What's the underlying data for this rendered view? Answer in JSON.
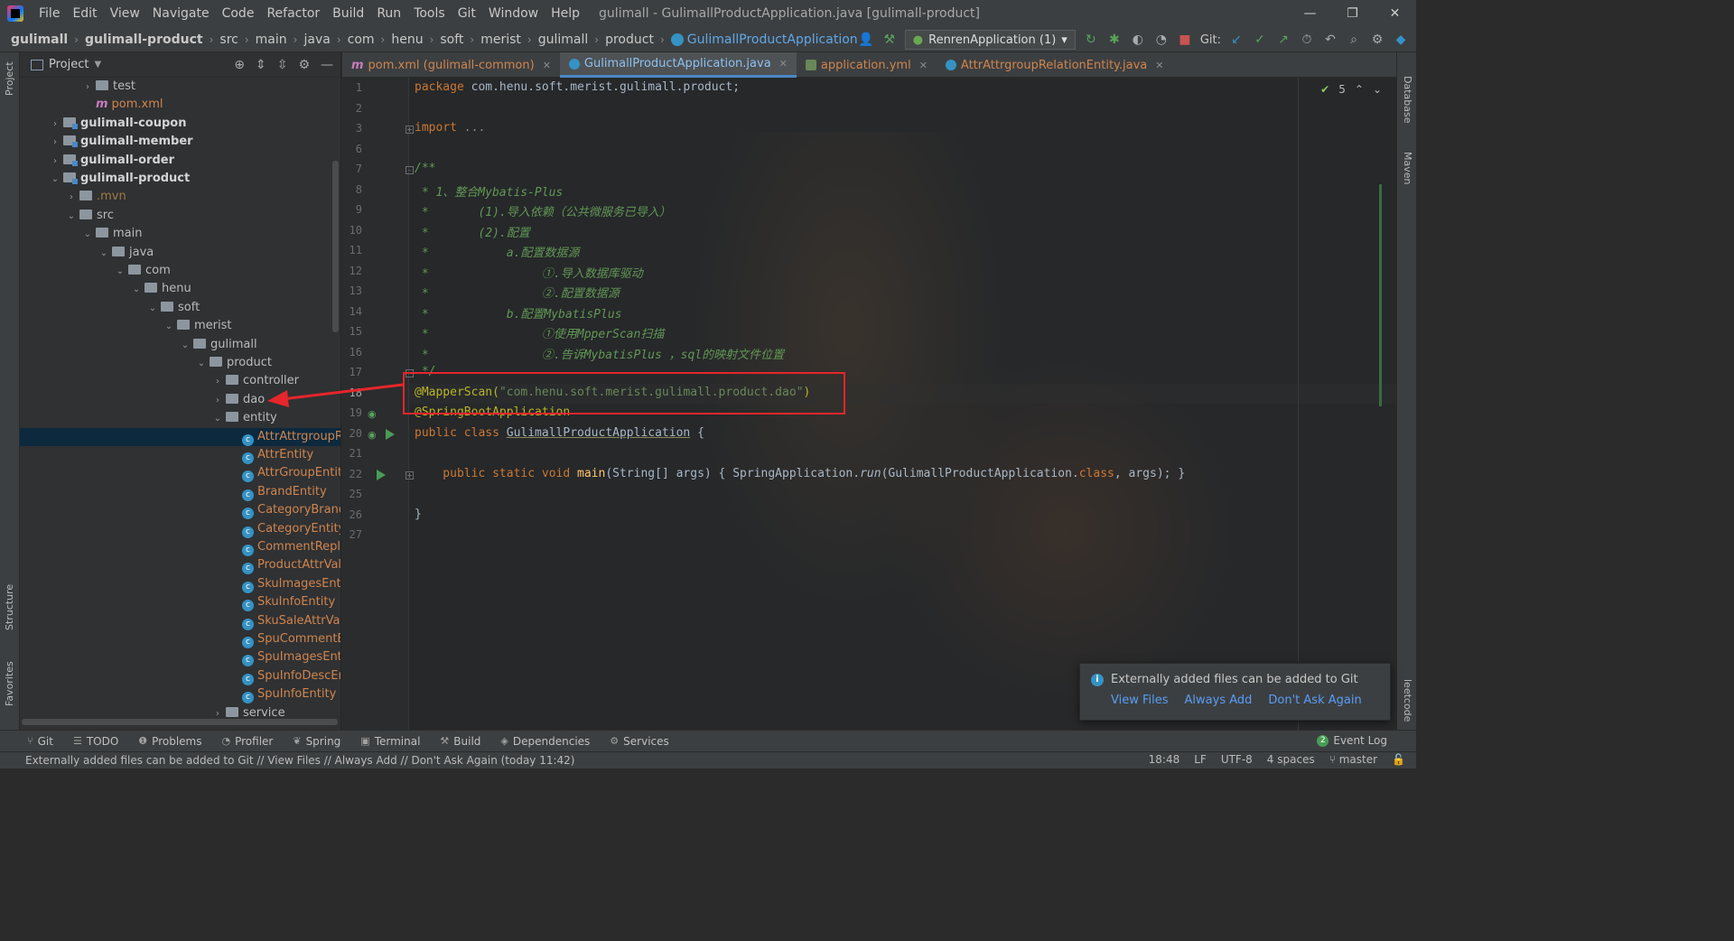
{
  "window": {
    "title": "gulimall - GulimallProductApplication.java [gulimall-product]",
    "menu": [
      "File",
      "Edit",
      "View",
      "Navigate",
      "Code",
      "Refactor",
      "Build",
      "Run",
      "Tools",
      "Git",
      "Window",
      "Help"
    ],
    "controls": [
      "—",
      "❐",
      "✕"
    ]
  },
  "navbar": {
    "crumbs": [
      "gulimall",
      "gulimall-product",
      "src",
      "main",
      "java",
      "com",
      "henu",
      "soft",
      "merist",
      "gulimall",
      "product",
      "GulimallProductApplication"
    ],
    "run_config": "RenrenApplication (1)",
    "git_label": "Git:"
  },
  "side": {
    "project": "Project",
    "structure": "Structure",
    "favorites": "Favorites",
    "database": "Database",
    "maven": "Maven",
    "leetcode": "leetcode"
  },
  "project_panel": {
    "title": "Project",
    "tree": [
      {
        "label": "test",
        "kind": "folder",
        "depth": 3,
        "arrow": "›"
      },
      {
        "label": "pom.xml",
        "kind": "maven",
        "depth": 3,
        "arrow": "",
        "style": "orange"
      },
      {
        "label": "gulimall-coupon",
        "kind": "module",
        "depth": 1,
        "arrow": "›",
        "style": "mod"
      },
      {
        "label": "gulimall-member",
        "kind": "module",
        "depth": 1,
        "arrow": "›",
        "style": "mod"
      },
      {
        "label": "gulimall-order",
        "kind": "module",
        "depth": 1,
        "arrow": "›",
        "style": "mod"
      },
      {
        "label": "gulimall-product",
        "kind": "module",
        "depth": 1,
        "arrow": "⌄",
        "style": "mod"
      },
      {
        "label": ".mvn",
        "kind": "folder",
        "depth": 2,
        "arrow": "›",
        "style": "dim"
      },
      {
        "label": "src",
        "kind": "folder",
        "depth": 2,
        "arrow": "⌄"
      },
      {
        "label": "main",
        "kind": "folder",
        "depth": 3,
        "arrow": "⌄"
      },
      {
        "label": "java",
        "kind": "folder",
        "depth": 4,
        "arrow": "⌄"
      },
      {
        "label": "com",
        "kind": "folder",
        "depth": 5,
        "arrow": "⌄"
      },
      {
        "label": "henu",
        "kind": "folder",
        "depth": 6,
        "arrow": "⌄"
      },
      {
        "label": "soft",
        "kind": "folder",
        "depth": 7,
        "arrow": "⌄"
      },
      {
        "label": "merist",
        "kind": "folder",
        "depth": 8,
        "arrow": "⌄"
      },
      {
        "label": "gulimall",
        "kind": "folder",
        "depth": 9,
        "arrow": "⌄"
      },
      {
        "label": "product",
        "kind": "folder",
        "depth": 10,
        "arrow": "⌄"
      },
      {
        "label": "controller",
        "kind": "folder",
        "depth": 11,
        "arrow": "›"
      },
      {
        "label": "dao",
        "kind": "folder",
        "depth": 11,
        "arrow": "›"
      },
      {
        "label": "entity",
        "kind": "folder",
        "depth": 11,
        "arrow": "⌄"
      },
      {
        "label": "AttrAttrgroupR",
        "kind": "class",
        "depth": 12,
        "arrow": "",
        "style": "orange",
        "selected": true
      },
      {
        "label": "AttrEntity",
        "kind": "class",
        "depth": 12,
        "arrow": "",
        "style": "orange"
      },
      {
        "label": "AttrGroupEntity",
        "kind": "class",
        "depth": 12,
        "arrow": "",
        "style": "orange"
      },
      {
        "label": "BrandEntity",
        "kind": "class",
        "depth": 12,
        "arrow": "",
        "style": "orange"
      },
      {
        "label": "CategoryBrand",
        "kind": "class",
        "depth": 12,
        "arrow": "",
        "style": "orange"
      },
      {
        "label": "CategoryEntity",
        "kind": "class",
        "depth": 12,
        "arrow": "",
        "style": "orange"
      },
      {
        "label": "CommentRepla",
        "kind": "class",
        "depth": 12,
        "arrow": "",
        "style": "orange"
      },
      {
        "label": "ProductAttrVal",
        "kind": "class",
        "depth": 12,
        "arrow": "",
        "style": "orange"
      },
      {
        "label": "SkuImagesEntit",
        "kind": "class",
        "depth": 12,
        "arrow": "",
        "style": "orange"
      },
      {
        "label": "SkuInfoEntity",
        "kind": "class",
        "depth": 12,
        "arrow": "",
        "style": "orange"
      },
      {
        "label": "SkuSaleAttrValu",
        "kind": "class",
        "depth": 12,
        "arrow": "",
        "style": "orange"
      },
      {
        "label": "SpuCommentEr",
        "kind": "class",
        "depth": 12,
        "arrow": "",
        "style": "orange"
      },
      {
        "label": "SpuImagesEntit",
        "kind": "class",
        "depth": 12,
        "arrow": "",
        "style": "orange"
      },
      {
        "label": "SpuInfoDescEnt",
        "kind": "class",
        "depth": 12,
        "arrow": "",
        "style": "orange"
      },
      {
        "label": "SpuInfoEntity",
        "kind": "class",
        "depth": 12,
        "arrow": "",
        "style": "orange"
      },
      {
        "label": "service",
        "kind": "folder",
        "depth": 11,
        "arrow": "›"
      }
    ]
  },
  "tabs": [
    {
      "label": "pom.xml (gulimall-common)",
      "icon": "maven-icon",
      "color": "#c77dbb",
      "active": false
    },
    {
      "label": "GulimallProductApplication.java",
      "icon": "spring-class-icon",
      "color": "#3592c4",
      "active": true
    },
    {
      "label": "application.yml",
      "icon": "yml-icon",
      "color": "#6a8759",
      "active": false
    },
    {
      "label": "AttrAttrgroupRelationEntity.java",
      "icon": "class-icon",
      "color": "#3592c4",
      "active": false
    }
  ],
  "editor": {
    "inspection_count": "5",
    "line_numbers": [
      "1",
      "2",
      "3",
      "6",
      "7",
      "8",
      "9",
      "10",
      "11",
      "12",
      "13",
      "14",
      "15",
      "16",
      "17",
      "18",
      "19",
      "20",
      "21",
      "22",
      "25",
      "26",
      "27"
    ],
    "lines": {
      "l1_kw": "package",
      "l1_rest": " com.henu.soft.merist.gulimall.product;",
      "l3_kw": "import",
      "l3_rest": " ...",
      "l7": "/**",
      "l8": " * 1、整合Mybatis-Plus",
      "l9": " *       (1).导入依赖（公共微服务已导入）",
      "l10": " *       (2).配置",
      "l11": " *           a.配置数据源",
      "l12": " *                ①.导入数据库驱动",
      "l13": " *                ②.配置数据源",
      "l14": " *           b.配置MybatisPlus",
      "l15": " *                ①使用MpperScan扫描",
      "l16": " *                ②.告诉MybatisPlus ，sql的映射文件位置",
      "l17": " */",
      "l18_an": "@MapperScan(",
      "l18_str": "\"com.henu.soft.merist.gulimall.product.dao\"",
      "l18_end": ")",
      "l19": "@SpringBootApplication",
      "l20_kw": "public class ",
      "l20_name": "GulimallProductApplication",
      "l20_end": " {",
      "l22_kw": "    public static void ",
      "l22_fn": "main",
      "l22_mid": "(String[] args) { SpringApplication.",
      "l22_run": "run",
      "l22_args": "(GulimallProductApplication.",
      "l22_class": "class",
      "l22_tail": ", args); }",
      "l26": "}"
    }
  },
  "notification": {
    "title": "Externally added files can be added to Git",
    "links": [
      "View Files",
      "Always Add",
      "Don't Ask Again"
    ]
  },
  "tool_windows": [
    {
      "label": "Git",
      "icon": "git-icon"
    },
    {
      "label": "TODO",
      "icon": "list-icon"
    },
    {
      "label": "Problems",
      "icon": "problems-icon"
    },
    {
      "label": "Profiler",
      "icon": "profiler-icon"
    },
    {
      "label": "Spring",
      "icon": "spring-icon"
    },
    {
      "label": "Terminal",
      "icon": "terminal-icon"
    },
    {
      "label": "Build",
      "icon": "hammer-icon"
    },
    {
      "label": "Dependencies",
      "icon": "dependencies-icon"
    },
    {
      "label": "Services",
      "icon": "services-icon"
    }
  ],
  "event_log": {
    "label": "Event Log",
    "count": "2"
  },
  "status": {
    "message": "Externally added files can be added to Git // View Files // Always Add // Don't Ask Again (today 11:42)",
    "position": "18:48",
    "line_sep": "LF",
    "encoding": "UTF-8",
    "indent": "4 spaces",
    "branch": "master"
  }
}
